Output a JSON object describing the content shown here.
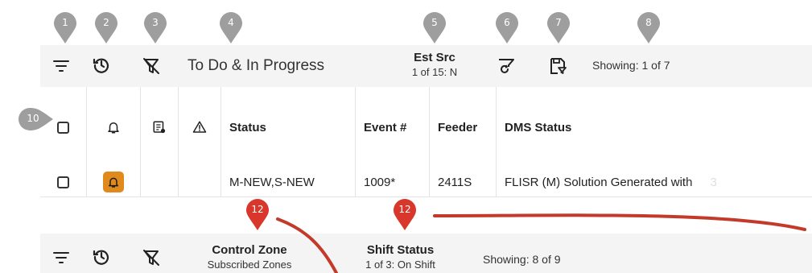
{
  "toolbar_top": {
    "filter_title": "To Do & In Progress",
    "est_src_label": "Est Src",
    "est_src_value": "1 of 15: N",
    "showing": "Showing: 1 of 7"
  },
  "callouts": {
    "c1": "1",
    "c2": "2",
    "c3": "3",
    "c4": "4",
    "c5": "5",
    "c6": "6",
    "c7": "7",
    "c8": "8",
    "c10": "10",
    "c12a": "12",
    "c12b": "12"
  },
  "grid": {
    "headers": {
      "status": "Status",
      "event": "Event #",
      "feeder": "Feeder",
      "dms_status": "DMS Status"
    },
    "row": {
      "status": "M-NEW,S-NEW",
      "event": "1009*",
      "feeder": "2411S",
      "dms_status": "FLISR (M) Solution Generated with",
      "trailing": "3"
    }
  },
  "toolbar_bottom": {
    "control_zone_label": "Control Zone",
    "control_zone_value": "Subscribed Zones",
    "shift_status_label": "Shift Status",
    "shift_status_value": "1 of 3: On Shift",
    "showing": "Showing: 8 of 9"
  },
  "colors": {
    "callout_gray": "#9e9e9e",
    "callout_red": "#d9372b",
    "bell_badge": "#e08a1e",
    "toolbar_bg": "#f4f4f4"
  }
}
